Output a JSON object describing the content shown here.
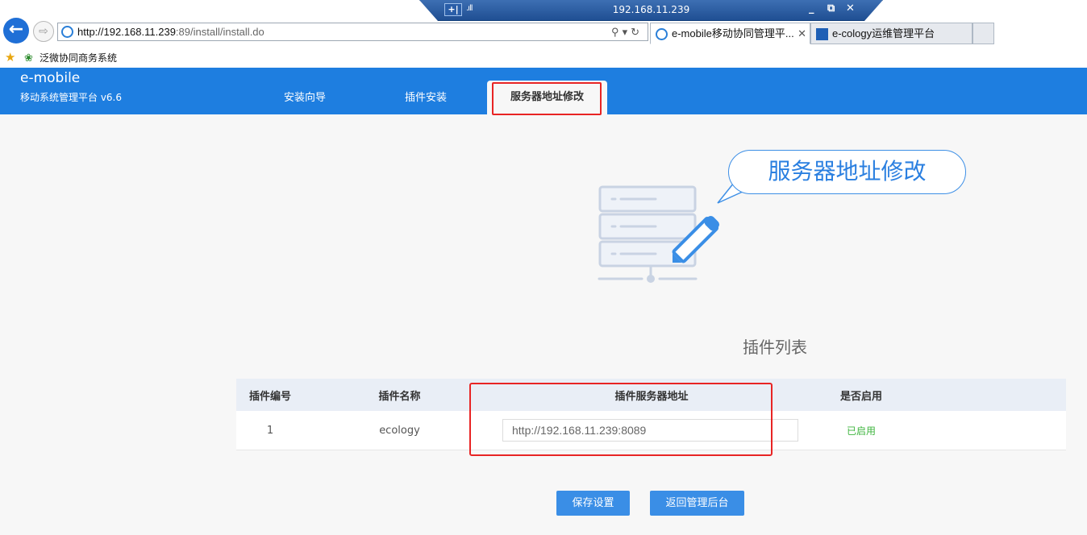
{
  "rdp": {
    "ip": "192.168.11.239",
    "pin_label": "+⊣"
  },
  "browser": {
    "url_host": "http://192.168.11.239",
    "url_rest": ":89/install/install.do",
    "tabs": [
      {
        "label": "e-mobile移动协同管理平..."
      },
      {
        "label": "e-cology运维管理平台"
      }
    ],
    "favorites": [
      {
        "label": "泛微协同商务系统"
      }
    ]
  },
  "app": {
    "brand_title": "e-mobile",
    "brand_subtitle": "移动系统管理平台 v6.6",
    "nav": [
      {
        "label": "安装向导"
      },
      {
        "label": "插件安装"
      },
      {
        "label": "服务器地址修改"
      }
    ],
    "bubble_text": "服务器地址修改",
    "section_title": "插件列表",
    "table": {
      "headers": [
        "插件编号",
        "插件名称",
        "插件服务器地址",
        "是否启用"
      ],
      "rows": [
        {
          "id": "1",
          "name": "ecology",
          "server_url": "http://192.168.11.239:8089",
          "enabled": "已启用"
        }
      ]
    },
    "buttons": {
      "save": "保存设置",
      "back": "返回管理后台"
    },
    "colors": {
      "header": "#1e7ee0",
      "button": "#3a8ee6",
      "highlight": "#e82424",
      "enabled": "#3fb53f"
    }
  }
}
